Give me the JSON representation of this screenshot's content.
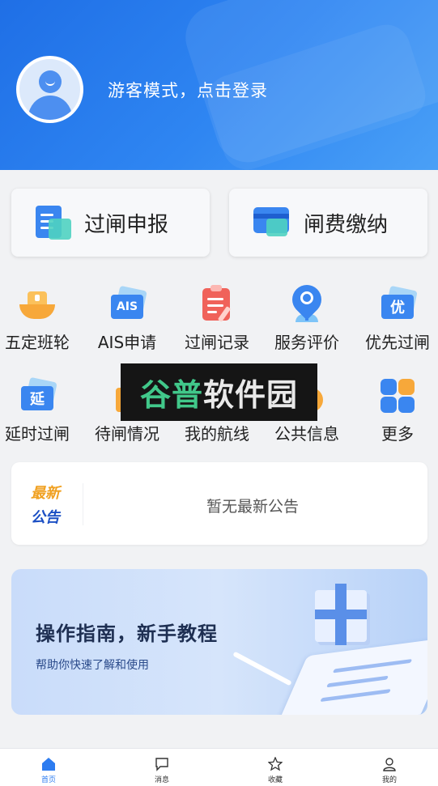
{
  "header": {
    "login_prompt": "游客模式，点击登录"
  },
  "quick_cards": [
    {
      "label": "过闸申报",
      "icon": "document-icon"
    },
    {
      "label": "闸费缴纳",
      "icon": "payment-card-icon"
    }
  ],
  "services_row1": [
    {
      "label": "五定班轮",
      "icon": "ship-icon"
    },
    {
      "label": "AIS申请",
      "icon": "ais-badge-icon",
      "badge": "AIS"
    },
    {
      "label": "过闸记录",
      "icon": "clipboard-icon"
    },
    {
      "label": "服务评价",
      "icon": "location-heart-icon"
    },
    {
      "label": "优先过闸",
      "icon": "priority-badge-icon",
      "badge": "优"
    }
  ],
  "services_row2": [
    {
      "label": "延时过闸",
      "icon": "delay-badge-icon",
      "badge": "延"
    },
    {
      "label": "待闸情况",
      "icon": "waiting-icon"
    },
    {
      "label": "我的航线",
      "icon": "route-icon"
    },
    {
      "label": "公共信息",
      "icon": "info-icon"
    },
    {
      "label": "更多",
      "icon": "more-tiles-icon"
    }
  ],
  "notice": {
    "tag_line1": "最新",
    "tag_line2": "公告",
    "text": "暂无最新公告"
  },
  "guide": {
    "title": "操作指南，新手教程",
    "subtitle": "帮助你快速了解和使用"
  },
  "watermark": {
    "part1": "谷普",
    "part2": "软件园"
  },
  "tabbar": [
    {
      "label": "首页",
      "icon": "home-icon",
      "active": true
    },
    {
      "label": "消息",
      "icon": "message-icon",
      "active": false
    },
    {
      "label": "收藏",
      "icon": "star-icon",
      "active": false
    },
    {
      "label": "我的",
      "icon": "user-icon",
      "active": false
    }
  ],
  "colors": {
    "primary": "#2d7cf0",
    "header_start": "#1f6fe6",
    "accent_teal": "#4fd1c1",
    "watermark_green": "#41c88a"
  }
}
